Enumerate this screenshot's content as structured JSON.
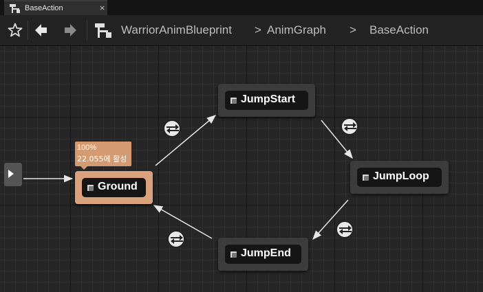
{
  "tab": {
    "title": "BaseAction",
    "close": "×"
  },
  "breadcrumb": [
    "WarriorAnimBlueprint",
    ">",
    "AnimGraph",
    ">",
    "BaseAction"
  ],
  "status": {
    "percent": "100%",
    "active_time": "22.055에 활성"
  },
  "nodes": {
    "ground": "Ground",
    "jump_start": "JumpStart",
    "jump_loop": "JumpLoop",
    "jump_end": "JumpEnd"
  },
  "colors": {
    "active_node": "#d9a27c",
    "tooltip": "#d49a72",
    "node": "#3c3c3c",
    "wire": "#e6e6e6"
  },
  "icons": [
    "blueprint-graph-icon",
    "star-icon",
    "back-arrow-icon",
    "forward-arrow-icon",
    "entry-icon",
    "transition-icon"
  ]
}
